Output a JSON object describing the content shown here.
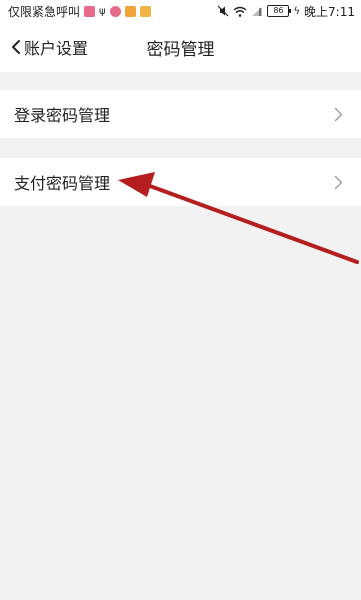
{
  "status_bar": {
    "carrier_text": "仅限紧急呼叫",
    "battery_level": "86",
    "time": "晚上7:11",
    "app_icon_colors": [
      "#e86a8a",
      "#f2a23b",
      "#f0b445"
    ]
  },
  "nav": {
    "back_label": "账户设置",
    "title": "密码管理"
  },
  "list": {
    "items": [
      {
        "label": "登录密码管理",
        "icon": "chevron-right-icon"
      },
      {
        "label": "支付密码管理",
        "icon": "chevron-right-icon"
      }
    ]
  },
  "annotation": {
    "color": "#b51e1e",
    "points_to": "支付密码管理"
  }
}
